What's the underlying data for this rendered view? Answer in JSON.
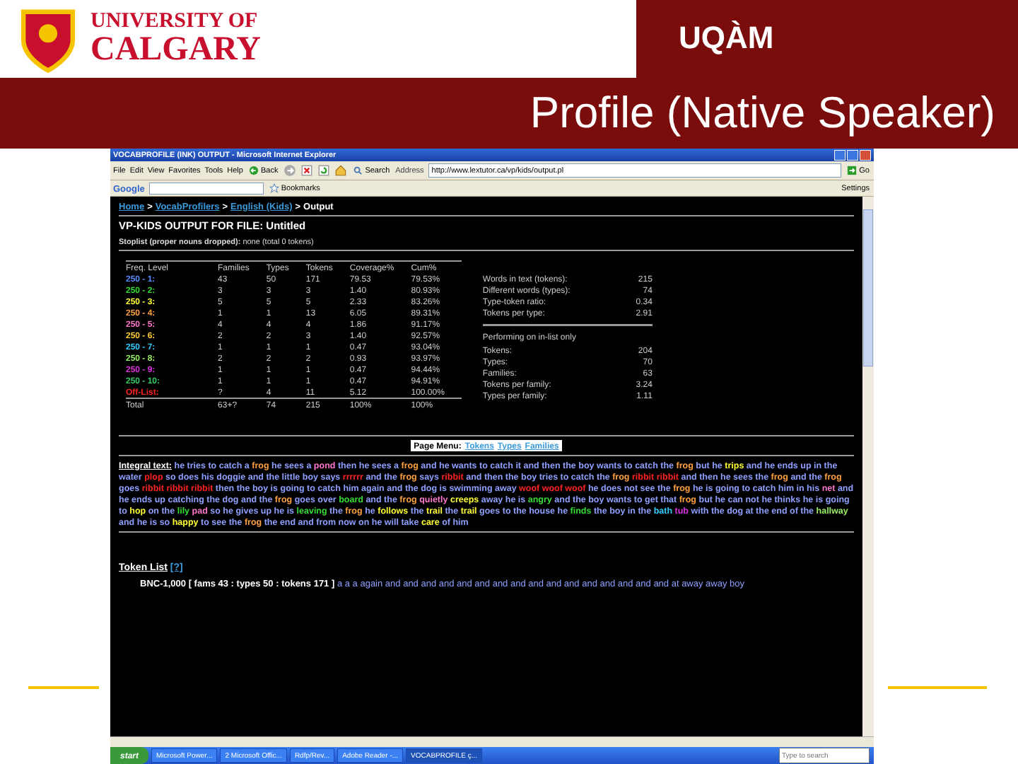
{
  "slide": {
    "logo_line1": "UNIVERSITY OF",
    "logo_line2": "CALGARY",
    "partner_logo": "UQÀM",
    "title": "Profile (Native Speaker)"
  },
  "browser": {
    "title": "VOCABPROFILE (INK) OUTPUT - Microsoft Internet Explorer",
    "menu": [
      "File",
      "Edit",
      "View",
      "Favorites",
      "Tools",
      "Help"
    ],
    "back_label": "Back",
    "search_label": "Search",
    "address_label": "Address",
    "address": "http://www.lextutor.ca/vp/kids/output.pl",
    "go_label": "Go",
    "google_label": "Google",
    "bookmarks_label": "Bookmarks",
    "settings_label": "Settings"
  },
  "page": {
    "breadcrumb_separator": ">",
    "breadcrumb": [
      {
        "label": "Home",
        "link": true
      },
      {
        "label": "VocabProfilers",
        "link": true
      },
      {
        "label": "English (Kids)",
        "link": true
      },
      {
        "label": "Output",
        "link": false
      }
    ],
    "heading": "VP-KIDS OUTPUT FOR FILE: Untitled",
    "stoplist": "**Stoplist (proper nouns dropped):** none (total 0 tokens)",
    "table": {
      "columns": [
        "Freq. Level",
        "Families",
        "Types",
        "Tokens",
        "Coverage%",
        "Cum%"
      ],
      "rows": [
        {
          "color": "#5b8cff",
          "cells": [
            "250 - 1:",
            "43",
            "50",
            "171",
            "79.53",
            "79.53%"
          ]
        },
        {
          "color": "#33dd33",
          "cells": [
            "250 - 2:",
            "3",
            "3",
            "3",
            "1.40",
            "80.93%"
          ]
        },
        {
          "color": "#ffff33",
          "cells": [
            "250 - 3:",
            "5",
            "5",
            "5",
            "2.33",
            "83.26%"
          ]
        },
        {
          "color": "#ffa040",
          "cells": [
            "250 - 4:",
            "1",
            "1",
            "13",
            "6.05",
            "89.31%"
          ]
        },
        {
          "color": "#ff77cc",
          "cells": [
            "250 - 5:",
            "4",
            "4",
            "4",
            "1.86",
            "91.17%"
          ]
        },
        {
          "color": "#ffcc33",
          "cells": [
            "250 - 6:",
            "2",
            "2",
            "3",
            "1.40",
            "92.57%"
          ]
        },
        {
          "color": "#33ccff",
          "cells": [
            "250 - 7:",
            "1",
            "1",
            "1",
            "0.47",
            "93.04%"
          ]
        },
        {
          "color": "#99ee66",
          "cells": [
            "250 - 8:",
            "2",
            "2",
            "2",
            "0.93",
            "93.97%"
          ]
        },
        {
          "color": "#dd33dd",
          "cells": [
            "250 - 9:",
            "1",
            "1",
            "1",
            "0.47",
            "94.44%"
          ]
        },
        {
          "color": "#33cc66",
          "cells": [
            "250 - 10:",
            "1",
            "1",
            "1",
            "0.47",
            "94.91%"
          ]
        },
        {
          "color": "#ff2222",
          "cells": [
            "Off-List:",
            "?",
            "4",
            "11",
            "5.12",
            "100.00%"
          ]
        }
      ],
      "total": [
        "Total",
        "63+?",
        "74",
        "215",
        "100%",
        "100%"
      ]
    },
    "stats": [
      {
        "label": "Words in text (tokens):",
        "value": "215"
      },
      {
        "label": "Different words (types):",
        "value": "74"
      },
      {
        "label": "Type-token ratio:",
        "value": "0.34"
      },
      {
        "label": "Tokens per type:",
        "value": "2.91"
      }
    ],
    "stats2_title": "Performing on in-list only",
    "stats2": [
      {
        "label": "Tokens:",
        "value": "204"
      },
      {
        "label": "Types:",
        "value": "70"
      },
      {
        "label": "Families:",
        "value": "63"
      },
      {
        "label": "Tokens per family:",
        "value": "3.24"
      },
      {
        "label": "Types per family:",
        "value": "1.11"
      }
    ],
    "page_menu_label": "Page Menu:",
    "page_menu_links": [
      "Tokens",
      "Types",
      "Families"
    ],
    "integral_label": "Integral text:",
    "integral_text": [
      {
        "t": "he tries to catch a",
        "color": "#8ea0ff"
      },
      {
        "t": "frog",
        "color": "#ffa040"
      },
      {
        "t": "he sees a",
        "color": "#8ea0ff"
      },
      {
        "t": "pond",
        "color": "#ff77cc"
      },
      {
        "t": "then he sees a",
        "color": "#8ea0ff"
      },
      {
        "t": "frog",
        "color": "#ffa040"
      },
      {
        "t": "and he wants to catch it and then the boy wants to catch the",
        "color": "#8ea0ff"
      },
      {
        "t": "frog",
        "color": "#ffa040"
      },
      {
        "t": "but he",
        "color": "#8ea0ff"
      },
      {
        "t": "trips",
        "color": "#ffff33"
      },
      {
        "t": "and he ends up in the water",
        "color": "#8ea0ff"
      },
      {
        "t": "plop",
        "color": "#ff2222"
      },
      {
        "t": "so does his doggie and the little boy says",
        "color": "#8ea0ff"
      },
      {
        "t": "rrrrrr",
        "color": "#ff2222"
      },
      {
        "t": "and the",
        "color": "#8ea0ff"
      },
      {
        "t": "frog",
        "color": "#ffa040"
      },
      {
        "t": "says",
        "color": "#8ea0ff"
      },
      {
        "t": "ribbit",
        "color": "#ff2222"
      },
      {
        "t": "and then the boy tries to catch the",
        "color": "#8ea0ff"
      },
      {
        "t": "frog",
        "color": "#ffa040"
      },
      {
        "t": "ribbit ribbit",
        "color": "#ff2222"
      },
      {
        "t": "and then he sees the",
        "color": "#8ea0ff"
      },
      {
        "t": "frog",
        "color": "#ffa040"
      },
      {
        "t": "and the",
        "color": "#8ea0ff"
      },
      {
        "t": "frog",
        "color": "#ffa040"
      },
      {
        "t": "goes",
        "color": "#8ea0ff"
      },
      {
        "t": "ribbit ribbit ribbit",
        "color": "#ff2222"
      },
      {
        "t": "then the boy is going to catch him again and the dog is swimming away",
        "color": "#8ea0ff"
      },
      {
        "t": "woof woof woof",
        "color": "#ff2222"
      },
      {
        "t": "he does not see the",
        "color": "#8ea0ff"
      },
      {
        "t": "frog",
        "color": "#ffa040"
      },
      {
        "t": "he is going to catch him in his",
        "color": "#8ea0ff"
      },
      {
        "t": "net",
        "color": "#ff77cc"
      },
      {
        "t": "and he ends up catching the dog and the",
        "color": "#8ea0ff"
      },
      {
        "t": "frog",
        "color": "#ffa040"
      },
      {
        "t": "goes over",
        "color": "#8ea0ff"
      },
      {
        "t": "board",
        "color": "#33dd33"
      },
      {
        "t": "and the",
        "color": "#8ea0ff"
      },
      {
        "t": "frog",
        "color": "#ffa040"
      },
      {
        "t": "quietly",
        "color": "#ff77cc"
      },
      {
        "t": "creeps",
        "color": "#ffff33"
      },
      {
        "t": "away he is",
        "color": "#8ea0ff"
      },
      {
        "t": "angry",
        "color": "#33dd33"
      },
      {
        "t": "and the boy wants to get that",
        "color": "#8ea0ff"
      },
      {
        "t": "frog",
        "color": "#ffa040"
      },
      {
        "t": "but he can not he thinks he is going to",
        "color": "#8ea0ff"
      },
      {
        "t": "hop",
        "color": "#ffff33"
      },
      {
        "t": "on the",
        "color": "#8ea0ff"
      },
      {
        "t": "lily",
        "color": "#33dd33"
      },
      {
        "t": "pad",
        "color": "#ff77cc"
      },
      {
        "t": "so he gives up he is",
        "color": "#8ea0ff"
      },
      {
        "t": "leaving",
        "color": "#33dd33"
      },
      {
        "t": "the",
        "color": "#8ea0ff"
      },
      {
        "t": "frog",
        "color": "#ffa040"
      },
      {
        "t": "he",
        "color": "#8ea0ff"
      },
      {
        "t": "follows",
        "color": "#ffff33"
      },
      {
        "t": "the",
        "color": "#8ea0ff"
      },
      {
        "t": "trail",
        "color": "#ffff33"
      },
      {
        "t": "the",
        "color": "#8ea0ff"
      },
      {
        "t": "trail",
        "color": "#ffff33"
      },
      {
        "t": "goes to the house he",
        "color": "#8ea0ff"
      },
      {
        "t": "finds",
        "color": "#33dd33"
      },
      {
        "t": "the boy in the",
        "color": "#8ea0ff"
      },
      {
        "t": "bath",
        "color": "#33ccff"
      },
      {
        "t": "tub",
        "color": "#dd33dd"
      },
      {
        "t": "with the dog at the end of the",
        "color": "#8ea0ff"
      },
      {
        "t": "hallway",
        "color": "#99ee66"
      },
      {
        "t": "and he is so",
        "color": "#8ea0ff"
      },
      {
        "t": "happy",
        "color": "#ffff33"
      },
      {
        "t": "to see the",
        "color": "#8ea0ff"
      },
      {
        "t": "frog",
        "color": "#ffa040"
      },
      {
        "t": "the end and from now on he will take",
        "color": "#8ea0ff"
      },
      {
        "t": "care",
        "color": "#ffff33"
      },
      {
        "t": "of him",
        "color": "#8ea0ff"
      }
    ],
    "token_list_title": "Token List",
    "token_list_help": "[?]",
    "token_summary": "BNC-1,000 [ fams 43 : types 50 : tokens 171 ]",
    "token_words": "a a a again and and and and and and and and and and and and and and and and at away away boy"
  },
  "taskbar": {
    "start": "start",
    "tasks": [
      {
        "label": "Microsoft Power...",
        "selected": false
      },
      {
        "label": "2 Microsoft Offic...",
        "selected": false
      },
      {
        "label": "Rdfp/Rev...",
        "selected": false
      },
      {
        "label": "Adobe Reader -...",
        "selected": false
      },
      {
        "label": "VOCABPROFILE ç...",
        "selected": true
      }
    ],
    "search_placeholder": "Type to search"
  }
}
